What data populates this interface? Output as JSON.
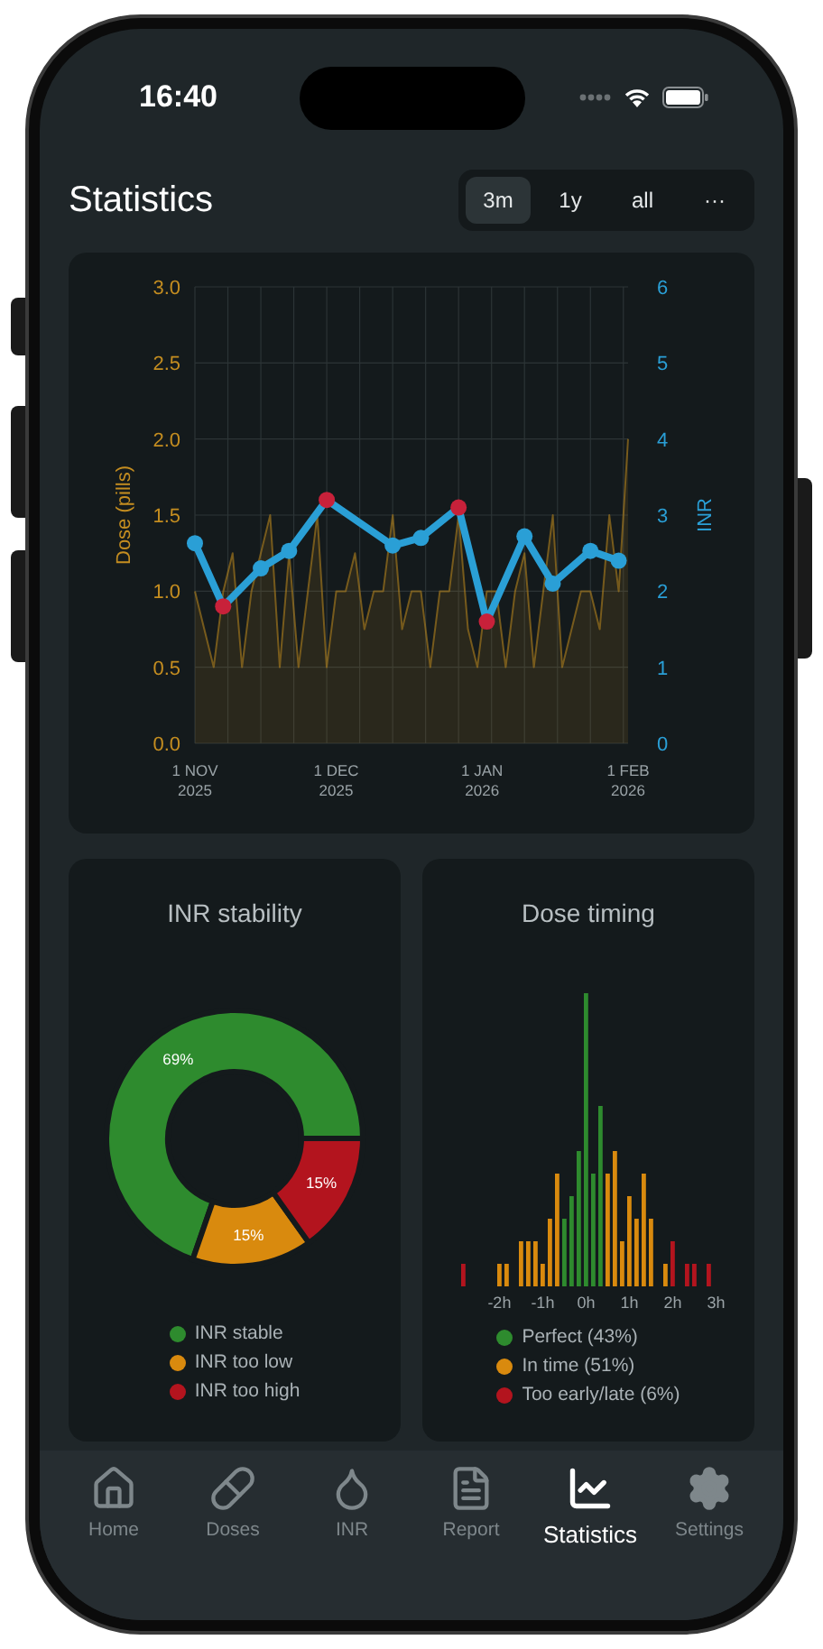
{
  "status_bar": {
    "time": "16:40"
  },
  "header": {
    "title": "Statistics"
  },
  "range_tabs": [
    {
      "label": "3m",
      "selected": true
    },
    {
      "label": "1y",
      "selected": false
    },
    {
      "label": "all",
      "selected": false
    },
    {
      "label": "···",
      "selected": false
    }
  ],
  "main_chart": {
    "chart_data": {
      "type": "line",
      "ylabel": "Dose (pills)",
      "y2label": "INR",
      "grid": true,
      "x": [
        "2025-11-01",
        "2025-11-03",
        "2025-11-05",
        "2025-11-07",
        "2025-11-09",
        "2025-11-11",
        "2025-11-13",
        "2025-11-15",
        "2025-11-17",
        "2025-11-19",
        "2025-11-21",
        "2025-11-23",
        "2025-11-25",
        "2025-11-27",
        "2025-11-29",
        "2025-12-01",
        "2025-12-03",
        "2025-12-05",
        "2025-12-07",
        "2025-12-09",
        "2025-12-11",
        "2025-12-13",
        "2025-12-15",
        "2025-12-17",
        "2025-12-19",
        "2025-12-21",
        "2025-12-23",
        "2025-12-25",
        "2025-12-27",
        "2025-12-29",
        "2025-12-31",
        "2026-01-02",
        "2026-01-04",
        "2026-01-06",
        "2026-01-08",
        "2026-01-10",
        "2026-01-12",
        "2026-01-14",
        "2026-01-16",
        "2026-01-18",
        "2026-01-20",
        "2026-01-22",
        "2026-01-24",
        "2026-01-26",
        "2026-01-28",
        "2026-01-30",
        "2026-02-01"
      ],
      "series": [
        {
          "color": "#c08a1e",
          "type": "area",
          "values": [
            1,
            0.75,
            0.5,
            1,
            1.25,
            0.5,
            1,
            1.25,
            1.5,
            0.5,
            1.25,
            0.5,
            1,
            1.5,
            0.5,
            1,
            1,
            1.25,
            0.75,
            1,
            1,
            1.5,
            0.75,
            1,
            1,
            0.5,
            1,
            1,
            1.5,
            0.75,
            0.5,
            1,
            1,
            0.5,
            1,
            1.25,
            0.5,
            1,
            1.5,
            0.5,
            0.75,
            1,
            1,
            0.75,
            1.5,
            1,
            2
          ]
        },
        {
          "color": "#2a9fd6",
          "axis": "y2",
          "marker": true,
          "values": [
            2.63,
            null,
            null,
            1.8,
            null,
            null,
            null,
            2.3,
            null,
            null,
            2.53,
            null,
            null,
            null,
            3.2,
            null,
            null,
            null,
            null,
            null,
            null,
            2.6,
            null,
            null,
            2.7,
            null,
            null,
            null,
            3.1,
            null,
            null,
            1.6,
            null,
            null,
            null,
            2.72,
            null,
            null,
            2.1,
            null,
            null,
            null,
            2.53,
            null,
            null,
            2.4,
            null
          ]
        }
      ],
      "xlim": [
        "2025-11-01",
        "2026-02-01"
      ],
      "ylim": [
        0,
        3
      ],
      "y2lim": [
        0,
        6
      ],
      "xticks": [
        {
          "value": "2025-11-01",
          "label": "1 NOV 2025"
        },
        {
          "value": "2025-12-01",
          "label": "1 DEC 2025"
        },
        {
          "value": "2026-01-01",
          "label": "1 JAN 2026"
        },
        {
          "value": "2026-02-01",
          "label": "1 FEB 2026"
        }
      ],
      "yticks": [
        {
          "value": 0,
          "label": "0.0"
        },
        {
          "value": 0.5,
          "label": "0.5"
        },
        {
          "value": 1,
          "label": "1.0"
        },
        {
          "value": 1.5,
          "label": "1.5"
        },
        {
          "value": 2,
          "label": "2.0"
        },
        {
          "value": 2.5,
          "label": "2.5"
        },
        {
          "value": 3,
          "label": "3.0"
        }
      ],
      "y2ticks": [
        0,
        1,
        2,
        3,
        4,
        5,
        6
      ]
    }
  },
  "inr_stability": {
    "title": "INR stability",
    "chart_data": {
      "type": "donut",
      "categories": [
        "INR stable",
        "INR too low",
        "INR too high"
      ],
      "values": [
        69,
        15,
        15
      ],
      "colors": [
        "#2e8b2e",
        "#d98a0e",
        "#b3141e"
      ],
      "value_labels": [
        "69%",
        "15%",
        "15%"
      ]
    }
  },
  "dose_timing": {
    "title": "Dose timing",
    "axis_labels": [
      "-2h",
      "-1h",
      "0h",
      "1h",
      "2h",
      "3h"
    ],
    "legend": [
      {
        "label": "Perfect (43%)",
        "color": "#2e8b2e"
      },
      {
        "label": "In time (51%)",
        "color": "#d98a0e"
      },
      {
        "label": "Too early/late (6%)",
        "color": "#b3141e"
      }
    ]
  },
  "tab_bar": [
    {
      "label": "Home",
      "selected": false
    },
    {
      "label": "Doses",
      "selected": false
    },
    {
      "label": "INR",
      "selected": false
    },
    {
      "label": "Report",
      "selected": false
    },
    {
      "label": "Statistics",
      "selected": true
    },
    {
      "label": "Settings",
      "selected": false
    }
  ]
}
